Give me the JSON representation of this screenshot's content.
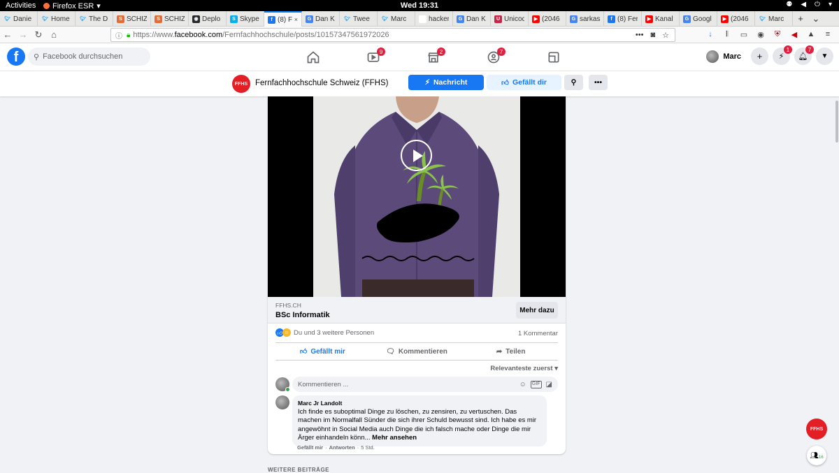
{
  "gnome": {
    "activities": "Activities",
    "app": "Firefox ESR",
    "clock": "Wed 19:31"
  },
  "tabs": [
    {
      "icon": "twitter",
      "color": "#1da1f2",
      "title": "Danie"
    },
    {
      "icon": "twitter",
      "color": "#1da1f2",
      "title": "Home"
    },
    {
      "icon": "twitter",
      "color": "#1da1f2",
      "title": "The D"
    },
    {
      "icon": "s-box",
      "color": "#e56b2f",
      "title": "SCHIZ"
    },
    {
      "icon": "s-box",
      "color": "#e56b2f",
      "title": "SCHIZ"
    },
    {
      "icon": "github",
      "color": "#24292e",
      "title": "Deplo"
    },
    {
      "icon": "skype",
      "color": "#00aff0",
      "title": "Skype"
    },
    {
      "icon": "facebook",
      "color": "#1877f2",
      "title": "(8) F",
      "active": true
    },
    {
      "icon": "google",
      "color": "#4285f4",
      "title": "Dan K"
    },
    {
      "icon": "twitter",
      "color": "#1da1f2",
      "title": "Twee"
    },
    {
      "icon": "twitter",
      "color": "#1da1f2",
      "title": "Marc"
    },
    {
      "icon": "blank",
      "color": "#ffffff",
      "title": "hackersca"
    },
    {
      "icon": "google",
      "color": "#4285f4",
      "title": "Dan K"
    },
    {
      "icon": "unicode",
      "color": "#cc2244",
      "title": "Unicod"
    },
    {
      "icon": "youtube",
      "color": "#ff0000",
      "title": "(2046"
    },
    {
      "icon": "google",
      "color": "#4285f4",
      "title": "sarkas"
    },
    {
      "icon": "facebook",
      "color": "#1877f2",
      "title": "(8) Fer"
    },
    {
      "icon": "youtube",
      "color": "#ff0000",
      "title": "Kanal"
    },
    {
      "icon": "google-translate",
      "color": "#4285f4",
      "title": "Googl"
    },
    {
      "icon": "youtube",
      "color": "#ff0000",
      "title": "(2046"
    },
    {
      "icon": "twitter",
      "color": "#1da1f2",
      "title": "Marc"
    }
  ],
  "url": {
    "prefix": "https://www.",
    "host": "facebook.com",
    "path": "/Fernfachhochschule/posts/10157347561972026"
  },
  "fb": {
    "search_placeholder": "Facebook durchsuchen",
    "badges": {
      "watch": "9",
      "marketplace": "2",
      "groups": "7",
      "messenger": "1",
      "notifications": "7"
    },
    "me": "Marc",
    "brand_color": "#1877f2"
  },
  "page": {
    "logo_text": "FFHS",
    "name": "Fernfachhochschule Schweiz (FFHS)",
    "message_label": "Nachricht",
    "liked_label": "Gefällt dir"
  },
  "post": {
    "link_domain": "FFHS.CH",
    "link_title": "BSc Informatik",
    "more_label": "Mehr dazu",
    "reactions_text": "Du und 3 weitere Personen",
    "comments_count": "1 Kommentar",
    "like_label": "Gefällt mir",
    "comment_label": "Kommentieren",
    "share_label": "Teilen",
    "sort_label": "Relevanteste zuerst",
    "comment_placeholder": "Kommentieren ...",
    "comment": {
      "author": "Marc Jr Landolt",
      "text": "Ich finde es suboptimal Dinge zu löschen, zu zensiren, zu vertuschen. Das machen im Normalfall Sünder die sich ihrer Schuld bewusst sind. Ich habe es mir angewöhnt in Social Media auch Dinge die ich falsch mache oder Dinge die mir Ärger einhandeln könn...",
      "more": "Mehr ansehen",
      "like": "Gefällt mir",
      "reply": "Antworten",
      "time": "5 Std."
    }
  },
  "weitere": "WEITERE BEITRÄGE",
  "fab_text": "FFHS",
  "contacts_count": "16"
}
